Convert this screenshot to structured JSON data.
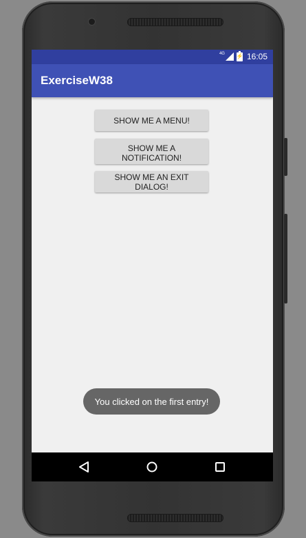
{
  "status_bar": {
    "network": "4G",
    "battery_glyph": "⚡",
    "time": "16:05"
  },
  "app_bar": {
    "title": "ExerciseW38"
  },
  "buttons": [
    {
      "label": "Show me a menu!"
    },
    {
      "label": "Show me a\nnotification!"
    },
    {
      "label": "Show me an exit dialog!"
    }
  ],
  "toast": {
    "message": "You clicked on the first entry!"
  },
  "nav_bar": {
    "back_icon": "back-triangle-icon",
    "home_icon": "home-circle-icon",
    "recents_icon": "recents-square-icon"
  },
  "colors": {
    "status_bar": "#303f9f",
    "app_bar": "#3f51b5",
    "background": "#f0f0f0",
    "button": "#d9d9d9",
    "toast": "#666666"
  }
}
